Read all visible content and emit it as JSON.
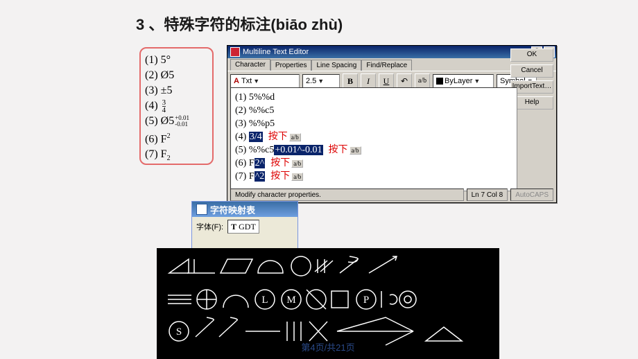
{
  "heading": "3 、特殊字符的标注(biāo zhù)",
  "example_box": {
    "rows": [
      {
        "idx": "(1)",
        "txt": "5°"
      },
      {
        "idx": "(2)",
        "txt": "Ø5"
      },
      {
        "idx": "(3)",
        "txt": "±5"
      },
      {
        "idx": "(4)",
        "txt": "",
        "frac_n": "3",
        "frac_d": "4"
      },
      {
        "idx": "(5)",
        "txt": "Ø5",
        "tol_up": "+0.01",
        "tol_dn": "-0.01"
      },
      {
        "idx": "(6)",
        "txt": "F",
        "sup": "2"
      },
      {
        "idx": "(7)",
        "txt": "F",
        "sub": "2"
      }
    ]
  },
  "mte": {
    "window_title": "Multiline Text Editor",
    "help_q": "?",
    "close_x": "×",
    "tabs": [
      "Character",
      "Properties",
      "Line Spacing",
      "Find/Replace"
    ],
    "active_tab": 0,
    "font_prefix": "A",
    "font_name": "Txt",
    "height": "2.5",
    "btn_bold": "B",
    "btn_italic": "I",
    "btn_under": "U",
    "btn_undo": "↶",
    "btn_frac_label": "a/b",
    "layer_value": "ByLayer",
    "symbol_label": "Symbol",
    "side_buttons": [
      "OK",
      "Cancel",
      "ImportText…",
      "Help"
    ],
    "body_lines": [
      {
        "idx": "(1)",
        "plain": "5%%d"
      },
      {
        "idx": "(2)",
        "plain": "%%c5"
      },
      {
        "idx": "(3)",
        "plain": "%%p5"
      },
      {
        "idx": "(4)",
        "hl": "3/4",
        "note": "按下",
        "frbtn": "a/b"
      },
      {
        "idx": "(5)",
        "plain": "%%c5",
        "hl": "+0.01^-0.01",
        "note": "按下",
        "frbtn": "a/b"
      },
      {
        "idx": "(6)",
        "plain": "F",
        "hl": "2^",
        "note": "按下",
        "frbtn": "a/b"
      },
      {
        "idx": "(7)",
        "plain": "F",
        "hl": "^2",
        "note": "按下",
        "frbtn": "a/b"
      }
    ],
    "status_msg": "Modify character properties.",
    "status_pos": "Ln 7 Col 8",
    "status_mode": "AutoCAPS"
  },
  "charmap": {
    "title": "字符映射表",
    "label": "字体(F):",
    "font_icon": "T",
    "font": "GDT"
  },
  "page_indicator": "第4页/共21页"
}
